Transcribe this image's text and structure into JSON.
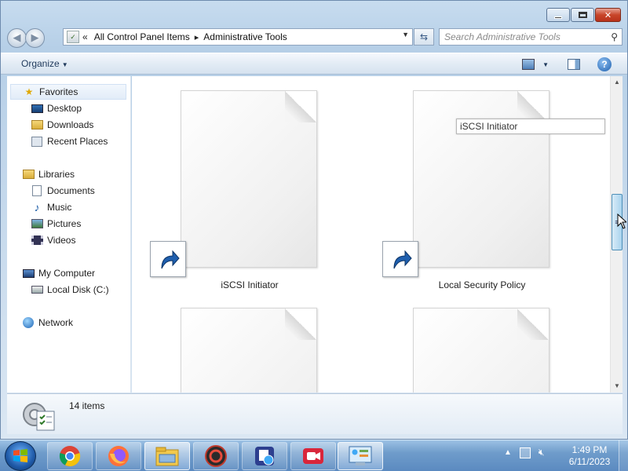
{
  "window": {
    "address": {
      "crumbs": [
        "All Control Panel Items",
        "Administrative Tools"
      ],
      "overflow": "«"
    },
    "search": {
      "placeholder": "Search Administrative Tools"
    },
    "toolbar": {
      "organize_label": "Organize"
    }
  },
  "navigation": {
    "favorites": {
      "label": "Favorites",
      "items": [
        "Desktop",
        "Downloads",
        "Recent Places"
      ]
    },
    "libraries": {
      "label": "Libraries",
      "items": [
        "Documents",
        "Music",
        "Pictures",
        "Videos"
      ]
    },
    "computer": {
      "label": "My Computer",
      "items": [
        "Local Disk (C:)"
      ]
    },
    "network": {
      "label": "Network"
    }
  },
  "content": {
    "items": [
      {
        "name": "iSCSI Initiator",
        "icon": "shortcut-document-icon"
      },
      {
        "name": "Local Security Policy",
        "icon": "shortcut-document-icon"
      },
      {
        "name": "",
        "icon": "document-icon"
      },
      {
        "name": "",
        "icon": "document-icon"
      }
    ],
    "rename_box": "iSCSI Initiator"
  },
  "details": {
    "item_count": "14 items"
  },
  "taskbar": {
    "apps": [
      "chrome",
      "firefox",
      "file-explorer",
      "media-app",
      "screen-capture-app",
      "video-recorder-app",
      "control-panel"
    ],
    "clock": {
      "time": "1:49 PM",
      "date": "6/11/2023"
    }
  },
  "colors": {
    "selection": "#e2ecf8",
    "taskbar": "#6f9ccb",
    "close_button": "#c8452a"
  }
}
